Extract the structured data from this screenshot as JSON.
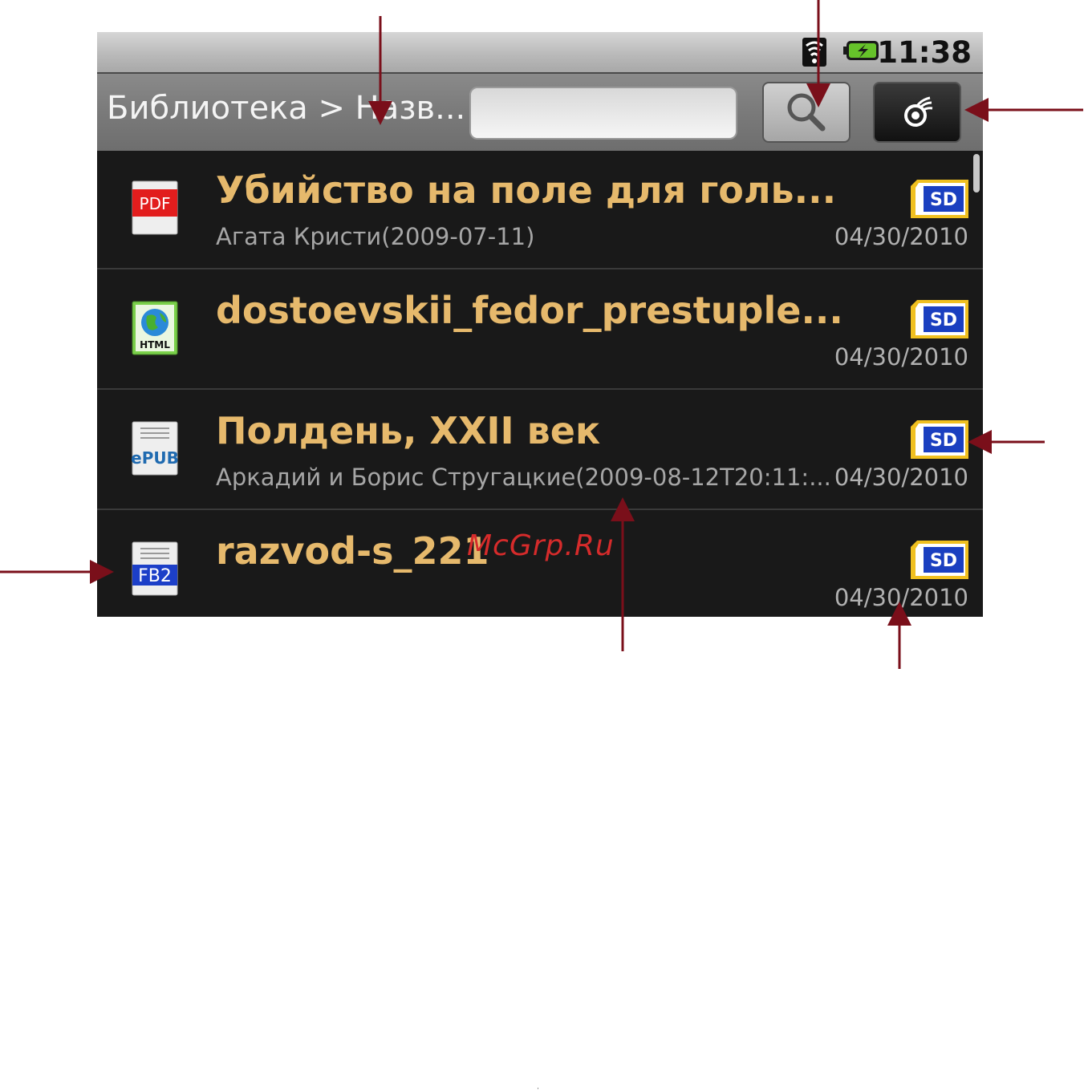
{
  "status_bar": {
    "time": "11:38",
    "signal_icon": "wifi-signal-icon",
    "battery_icon": "battery-charging-icon"
  },
  "title_bar": {
    "breadcrumb": "Библиотека > Назв...",
    "search_placeholder": "",
    "search_button_icon": "magnifier-icon",
    "mode_button_icon": "eye-icon"
  },
  "books": [
    {
      "format": "PDF",
      "icon": "pdf-file-icon",
      "title": "Убийство на поле для голь...",
      "meta": "Агата Кристи(2009-07-11)",
      "storage": "SD",
      "date": "04/30/2010"
    },
    {
      "format": "HTML",
      "icon": "html-globe-icon",
      "title": "dostoevskii_fedor_prestuple...",
      "meta": "",
      "storage": "SD",
      "date": "04/30/2010"
    },
    {
      "format": "ePUB",
      "icon": "epub-file-icon",
      "title": "Полдень, XXII век",
      "meta": "Аркадий и Борис Стругацкие(2009-08-12T20:11:...",
      "storage": "SD",
      "date": "04/30/2010"
    },
    {
      "format": "FB2",
      "icon": "fb2-file-icon",
      "title": "razvod-s_221",
      "meta": "",
      "storage": "SD",
      "date": "04/30/2010"
    }
  ],
  "watermark": "McGrp.Ru",
  "annotation_color": "#7a0f1a",
  "title_color": "#e6b96c",
  "sd_color": "#1a3fc0"
}
